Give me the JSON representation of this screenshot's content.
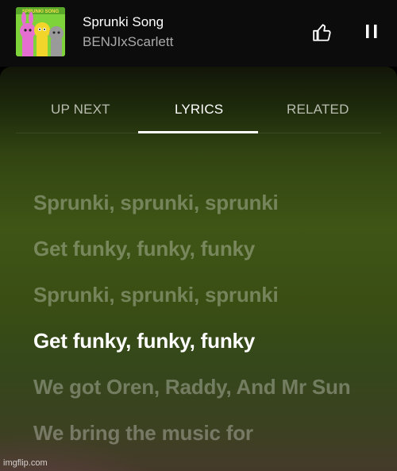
{
  "player": {
    "title": "Sprunki Song",
    "artist": "BENJIxScarlett",
    "thumbnail_text": "SPRUNKI SONG",
    "like_icon": "thumbs-up-icon",
    "pause_icon": "pause-icon"
  },
  "tabs": [
    {
      "label": "UP NEXT",
      "active": false
    },
    {
      "label": "LYRICS",
      "active": true
    },
    {
      "label": "RELATED",
      "active": false
    }
  ],
  "lyrics": [
    {
      "text": "Sprunki, sprunki, sprunki",
      "current": false
    },
    {
      "text": "Get funky, funky, funky",
      "current": false
    },
    {
      "text": "Sprunki, sprunki, sprunki",
      "current": false
    },
    {
      "text": "Get funky, funky, funky",
      "current": true
    },
    {
      "text": "We got Oren, Raddy, And Mr Sun",
      "current": false
    },
    {
      "text": "We bring the music for",
      "current": false
    }
  ],
  "watermark": "imgflip.com",
  "colors": {
    "active_text": "#ffffff",
    "inactive_lyric": "rgba(255,255,255,0.30)",
    "background_green": "#3f5516"
  }
}
